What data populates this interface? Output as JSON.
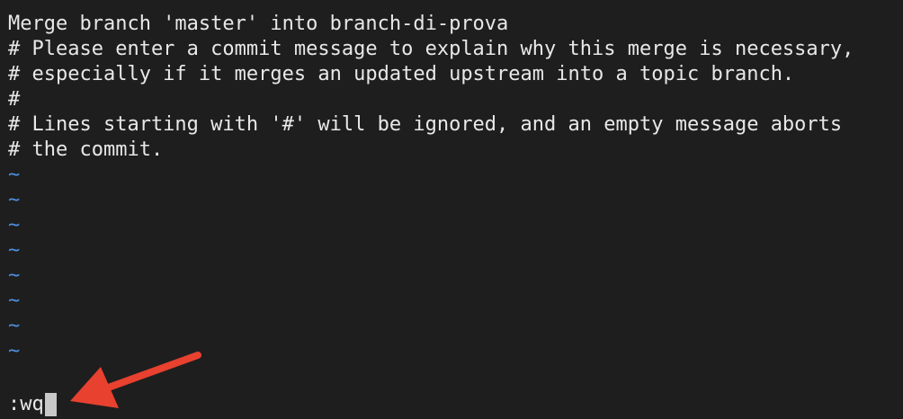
{
  "buffer": {
    "lines": [
      "Merge branch 'master' into branch-di-prova",
      "# Please enter a commit message to explain why this merge is necessary,",
      "# especially if it merges an updated upstream into a topic branch.",
      "#",
      "# Lines starting with '#' will be ignored, and an empty message aborts",
      "# the commit."
    ],
    "empty_line_marker": "~"
  },
  "command_line": {
    "text": ":wq"
  },
  "colors": {
    "background": "#1e1e1e",
    "text": "#e8e8e8",
    "tilde": "#4f8fe0",
    "arrow": "#e8412f"
  },
  "annotation": {
    "icon": "red-arrow-icon"
  }
}
